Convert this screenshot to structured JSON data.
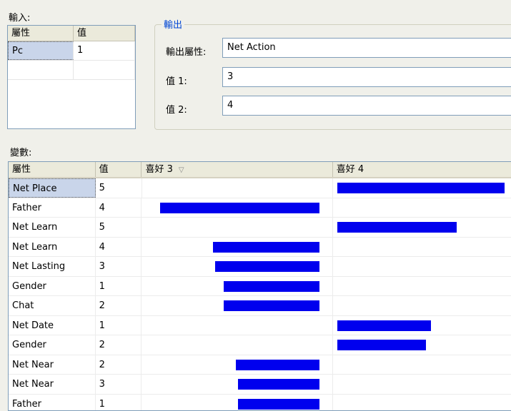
{
  "input": {
    "label": "輸入:",
    "headers": [
      "屬性",
      "值"
    ],
    "rows": [
      {
        "attr": "Pc",
        "value": "1"
      }
    ]
  },
  "output": {
    "legend": "輸出",
    "fields": [
      {
        "label": "輸出屬性:",
        "value": "Net Action"
      },
      {
        "label": "值 1:",
        "value": "3"
      },
      {
        "label": "值 2:",
        "value": "4"
      }
    ]
  },
  "variables": {
    "label": "變數:",
    "headers": [
      "屬性",
      "值",
      "喜好 3",
      "喜好 4"
    ],
    "rows": [
      {
        "attr": "Net Place",
        "value": "5",
        "pref3": 0,
        "pref4": 0.98
      },
      {
        "attr": "Father",
        "value": "4",
        "pref3": 0.9,
        "pref4": 0
      },
      {
        "attr": "Net Learn",
        "value": "5",
        "pref3": 0,
        "pref4": 0.7
      },
      {
        "attr": "Net Learn",
        "value": "4",
        "pref3": 0.6,
        "pref4": 0
      },
      {
        "attr": "Net Lasting",
        "value": "3",
        "pref3": 0.59,
        "pref4": 0
      },
      {
        "attr": "Gender",
        "value": "1",
        "pref3": 0.54,
        "pref4": 0
      },
      {
        "attr": "Chat",
        "value": "2",
        "pref3": 0.54,
        "pref4": 0
      },
      {
        "attr": "Net Date",
        "value": "1",
        "pref3": 0,
        "pref4": 0.55
      },
      {
        "attr": "Gender",
        "value": "2",
        "pref3": 0,
        "pref4": 0.52
      },
      {
        "attr": "Net Near",
        "value": "2",
        "pref3": 0.47,
        "pref4": 0
      },
      {
        "attr": "Net Near",
        "value": "3",
        "pref3": 0.46,
        "pref4": 0
      },
      {
        "attr": "Father",
        "value": "1",
        "pref3": 0.46,
        "pref4": 0
      }
    ]
  },
  "colors": {
    "bar": "#0000ee",
    "legend": "#0046d5"
  }
}
